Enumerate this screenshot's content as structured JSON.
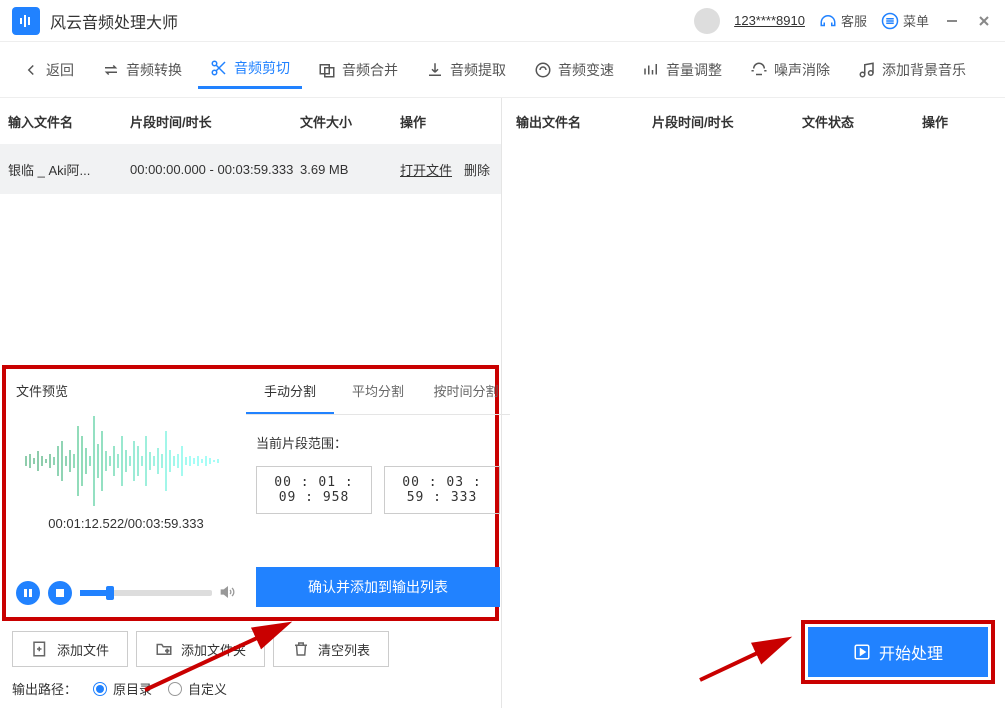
{
  "app": {
    "title": "风云音频处理大师"
  },
  "user": {
    "id": "123****8910",
    "service": "客服",
    "menu": "菜单"
  },
  "toolbar": {
    "back": "返回",
    "items": [
      "音频转换",
      "音频剪切",
      "音频合并",
      "音频提取",
      "音频变速",
      "音量调整",
      "噪声消除",
      "添加背景音乐"
    ],
    "active_index": 1
  },
  "input_table": {
    "headers": [
      "输入文件名",
      "片段时间/时长",
      "文件大小",
      "操作"
    ],
    "row": {
      "name": "银临 _ Aki阿...",
      "time": "00:00:00.000 - 00:03:59.333",
      "size": "3.69 MB",
      "open": "打开文件",
      "delete": "删除"
    }
  },
  "output_table": {
    "headers": [
      "输出文件名",
      "片段时间/时长",
      "文件状态",
      "操作"
    ]
  },
  "editor": {
    "preview_label": "文件预览",
    "time_display": "00:01:12.522/00:03:59.333",
    "tabs": [
      "手动分割",
      "平均分割",
      "按时间分割"
    ],
    "range_label": "当前片段范围：",
    "start": "00 : 01 : 09 : 958",
    "end": "00 : 03 : 59 : 333",
    "confirm": "确认并添加到输出列表"
  },
  "bottom": {
    "add_file": "添加文件",
    "add_folder": "添加文件夹",
    "clear": "清空列表",
    "output_path": "输出路径：",
    "original": "原目录",
    "custom": "自定义",
    "start": "开始处理"
  }
}
